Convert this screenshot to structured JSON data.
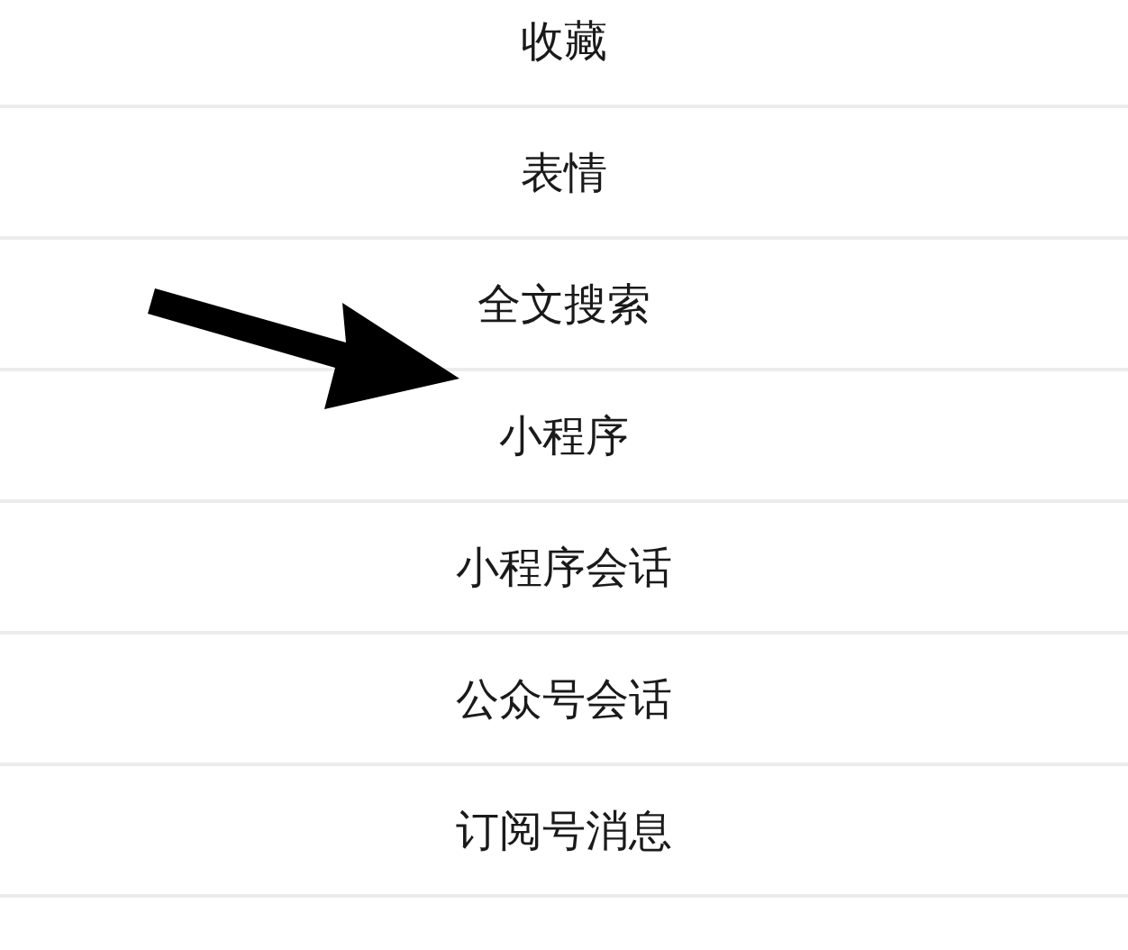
{
  "menu_items": [
    {
      "label": "收藏"
    },
    {
      "label": "表情"
    },
    {
      "label": "全文搜索"
    },
    {
      "label": "小程序"
    },
    {
      "label": "小程序会话"
    },
    {
      "label": "公众号会话"
    },
    {
      "label": "订阅号消息"
    }
  ]
}
